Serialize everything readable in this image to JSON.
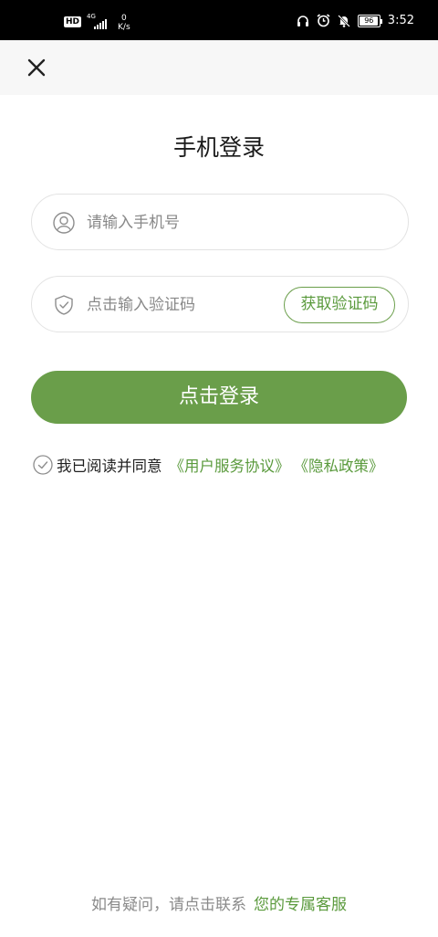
{
  "status_bar": {
    "hd": "HD",
    "network": "4G",
    "speed_value": "0",
    "speed_unit": "K/s",
    "battery": "96",
    "time": "3:52"
  },
  "nav": {
    "close_icon": "close-icon"
  },
  "page": {
    "title": "手机登录"
  },
  "phone": {
    "icon": "user-icon",
    "placeholder": "请输入手机号"
  },
  "code": {
    "icon": "shield-icon",
    "placeholder": "点击输入验证码",
    "get_code_label": "获取验证码"
  },
  "login": {
    "label": "点击登录"
  },
  "agreement": {
    "text": "我已阅读并同意",
    "user_agreement": "《用户服务协议》",
    "privacy_policy": "《隐私政策》"
  },
  "footer": {
    "text": "如有疑问，请点击联系",
    "link": "您的专属客服"
  },
  "colors": {
    "accent": "#6a9e4a",
    "link": "#5a9a3c",
    "status_bar": "#000000"
  }
}
